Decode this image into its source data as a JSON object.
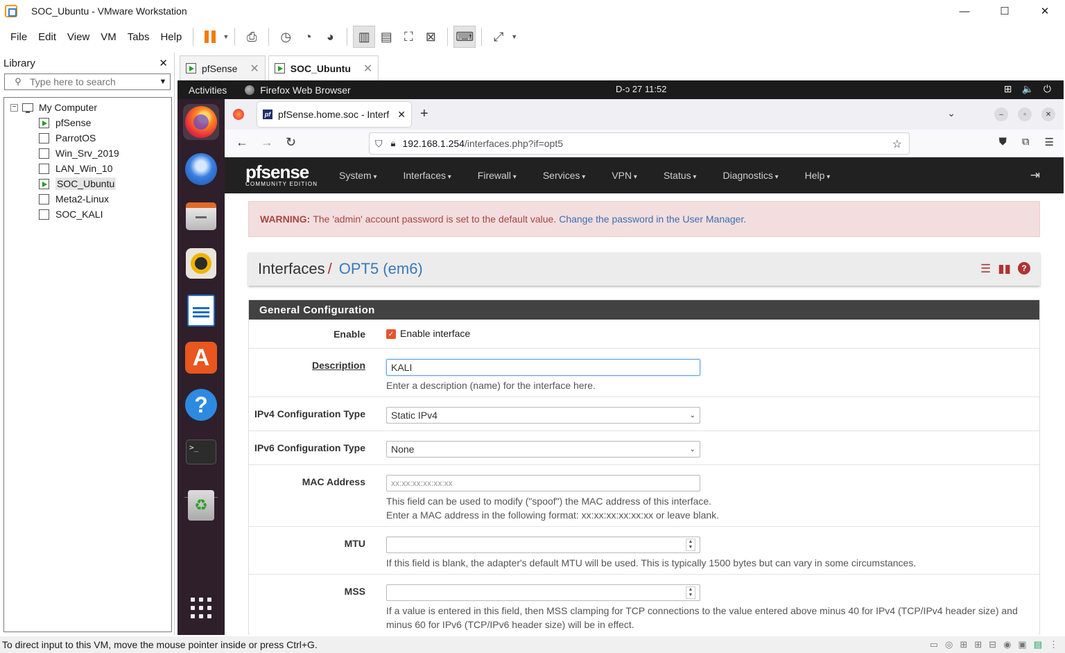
{
  "window": {
    "title": "SOC_Ubuntu - VMware Workstation"
  },
  "menubar": {
    "items": [
      "File",
      "Edit",
      "View",
      "VM",
      "Tabs",
      "Help"
    ]
  },
  "library": {
    "title": "Library",
    "search_placeholder": "Type here to search",
    "root": "My Computer",
    "vms": [
      {
        "name": "pfSense",
        "running": true
      },
      {
        "name": "ParrotOS",
        "running": false
      },
      {
        "name": "Win_Srv_2019",
        "running": false
      },
      {
        "name": "LAN_Win_10",
        "running": false
      },
      {
        "name": "SOC_Ubuntu",
        "running": true,
        "selected": true
      },
      {
        "name": "Meta2-Linux",
        "running": false
      },
      {
        "name": "SOC_KALI",
        "running": false
      }
    ]
  },
  "vm_tabs": [
    {
      "label": "pfSense",
      "active": false
    },
    {
      "label": "SOC_Ubuntu",
      "active": true
    }
  ],
  "gnome": {
    "activities": "Activities",
    "app_name": "Firefox Web Browser",
    "clock": "D-ɔ 27  11:52"
  },
  "firefox": {
    "tab_title": "pfSense.home.soc - Interf",
    "url_host": "192.168.1.254",
    "url_path": "/interfaces.php?if=opt5"
  },
  "pfsense": {
    "logo_text": "pfsense",
    "logo_sub": "COMMUNITY EDITION",
    "nav": [
      "System",
      "Interfaces",
      "Firewall",
      "Services",
      "VPN",
      "Status",
      "Diagnostics",
      "Help"
    ],
    "warning_label": "WARNING:",
    "warning_text": "The 'admin' account password is set to the default value.",
    "warning_link": "Change the password in the User Manager.",
    "breadcrumb_root": "Interfaces",
    "breadcrumb_sep": "/",
    "breadcrumb_current": "OPT5 (em6)",
    "panel_title": "General Configuration",
    "form": {
      "enable_label": "Enable",
      "enable_text": "Enable interface",
      "description_label": "Description",
      "description_value": "KALI",
      "description_hint": "Enter a description (name) for the interface here.",
      "ipv4_label": "IPv4 Configuration Type",
      "ipv4_value": "Static IPv4",
      "ipv6_label": "IPv6 Configuration Type",
      "ipv6_value": "None",
      "mac_label": "MAC Address",
      "mac_placeholder": "xx:xx:xx:xx:xx:xx",
      "mac_hint1": "This field can be used to modify (\"spoof\") the MAC address of this interface.",
      "mac_hint2": "Enter a MAC address in the following format: xx:xx:xx:xx:xx:xx or leave blank.",
      "mtu_label": "MTU",
      "mtu_hint": "If this field is blank, the adapter's default MTU will be used. This is typically 1500 bytes but can vary in some circumstances.",
      "mss_label": "MSS",
      "mss_hint1": "If a value is entered in this field, then MSS clamping for TCP connections to the value entered above minus 40 for IPv4 (TCP/IPv4 header size) and",
      "mss_hint2": "minus 60 for IPv6 (TCP/IPv6 header size) will be in effect."
    }
  },
  "statusbar": {
    "text": "To direct input to this VM, move the mouse pointer inside or press Ctrl+G."
  }
}
